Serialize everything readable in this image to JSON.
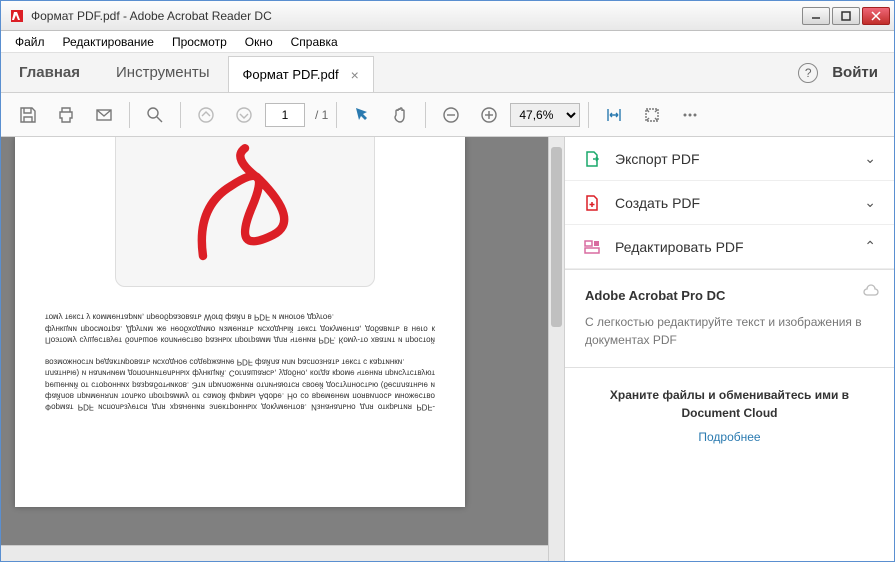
{
  "window": {
    "title": "Формат PDF.pdf - Adobe Acrobat Reader DC"
  },
  "menu": {
    "file": "Файл",
    "edit": "Редактирование",
    "view": "Просмотр",
    "window": "Окно",
    "help": "Справка"
  },
  "tabs": {
    "home": "Главная",
    "tools": "Инструменты",
    "doc": "Формат PDF.pdf",
    "login": "Войти"
  },
  "toolbar": {
    "page_current": "1",
    "page_total": "/ 1",
    "zoom": "47,6%",
    "zoom_options": [
      "47,6%"
    ]
  },
  "right_panel": {
    "items": [
      {
        "icon": "export",
        "label": "Экспорт PDF",
        "expanded": false
      },
      {
        "icon": "create",
        "label": "Создать PDF",
        "expanded": false
      },
      {
        "icon": "edit",
        "label": "Редактировать PDF",
        "expanded": true
      }
    ],
    "promo_title": "Adobe Acrobat Pro DC",
    "promo_text": "С легкостью редактируйте текст и изображения в документах PDF",
    "cloud_title": "Храните файлы и обменивайтесь ими в Document Cloud",
    "cloud_link": "Подробнее"
  },
  "document": {
    "paragraphs": [
      "Формат PDF используется для хранения электронных документов. Изначально для открытия PDF-файлов применяли только программу от самой фирмы Adobe. Но со временем появилось множество решений от сторонних разработчиков. Эти приложения отличаются своей доступностью (бесплатные и платные) и наличием дополнительных функций. Соглашаясь, удобно, когда кроме чтения присутствуют возможности редактировать исходное содержание PDF файла или распознать текст с картинки.",
      "Поэтому существует большое количество разных программ для чтения PDF. Кому-то хватит и простой функции просмотра. Другим же необходимо изменять исходный текст документа, добавить в него к тому текст у комментарии, преобразовать Word файл в PDF и многое другое."
    ]
  }
}
